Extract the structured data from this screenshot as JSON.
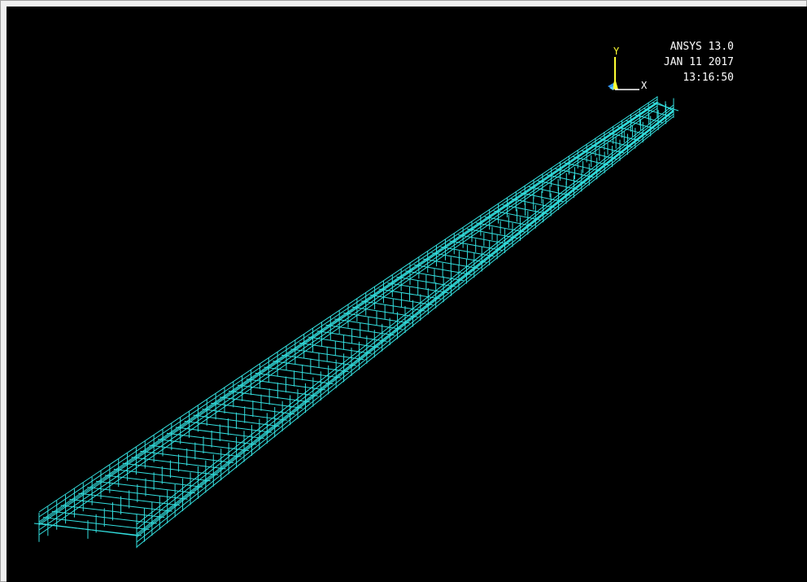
{
  "graphics": {
    "product": "ANSYS 13.0",
    "date": "JAN 11 2017",
    "time": "13:16:50",
    "background_color": "#000000",
    "mesh_color": "#33e0e0"
  },
  "triad": {
    "y_label": "Y",
    "x_label": "X",
    "y_color": "#ffff33",
    "x_color": "#ffffff"
  }
}
